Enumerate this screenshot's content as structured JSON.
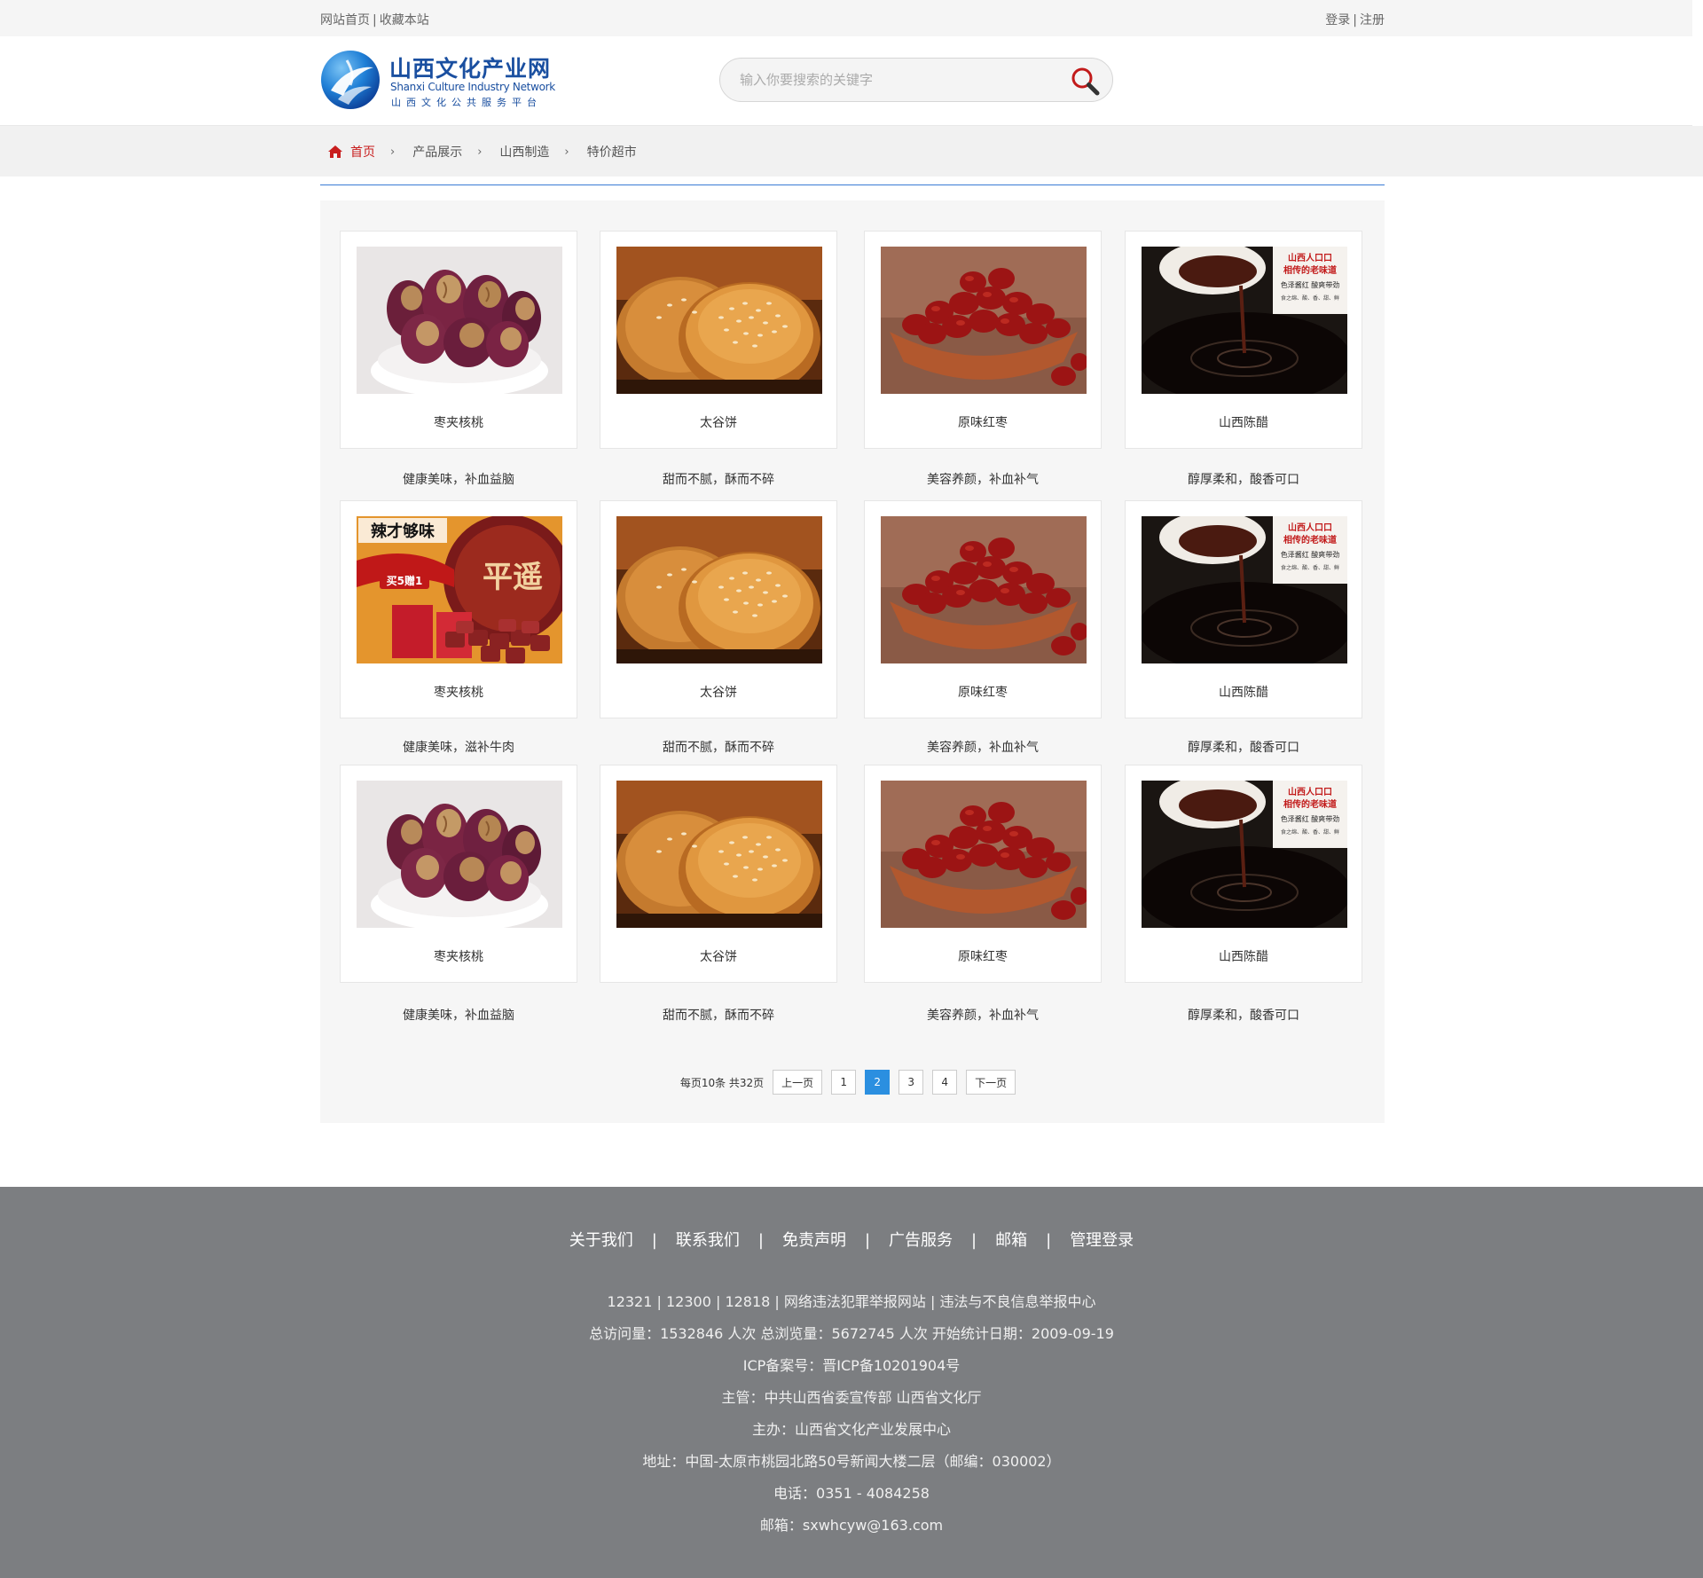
{
  "topbar": {
    "home_link": "网站首页",
    "bookmark_link": "收藏本站",
    "separator": "|",
    "login_link": "登录",
    "register_link": "注册"
  },
  "logo": {
    "name_cn": "山西文化产业网",
    "name_en": "Shanxi Culture Industry Network",
    "subtitle": "山西文化公共服务平台"
  },
  "search": {
    "placeholder": "输入你要搜索的关键字"
  },
  "breadcrumb": {
    "home": "首页",
    "items": [
      "产品展示",
      "山西制造",
      "特价超市"
    ],
    "arrow": "›"
  },
  "products": [
    {
      "name": "枣夹核桃",
      "desc": "健康美味，补血益脑",
      "image": "walnut-dates"
    },
    {
      "name": "太谷饼",
      "desc": "甜而不腻，酥而不碎",
      "image": "taigu-cake"
    },
    {
      "name": "原味红枣",
      "desc": "美容养颜，补血补气",
      "image": "red-dates"
    },
    {
      "name": "山西陈醋",
      "desc": "醇厚柔和，酸香可口",
      "image": "vinegar"
    },
    {
      "name": "枣夹核桃",
      "desc": "健康美味，滋补牛肉",
      "image": "beef-jerky"
    },
    {
      "name": "太谷饼",
      "desc": "甜而不腻，酥而不碎",
      "image": "taigu-cake"
    },
    {
      "name": "原味红枣",
      "desc": "美容养颜，补血补气",
      "image": "red-dates"
    },
    {
      "name": "山西陈醋",
      "desc": "醇厚柔和，酸香可口",
      "image": "vinegar"
    },
    {
      "name": "枣夹核桃",
      "desc": "健康美味，补血益脑",
      "image": "walnut-dates"
    },
    {
      "name": "太谷饼",
      "desc": "甜而不腻，酥而不碎",
      "image": "taigu-cake"
    },
    {
      "name": "原味红枣",
      "desc": "美容养颜，补血补气",
      "image": "red-dates"
    },
    {
      "name": "山西陈醋",
      "desc": "醇厚柔和，酸香可口",
      "image": "vinegar"
    }
  ],
  "image_text": {
    "vinegar_l1": "山西人口口",
    "vinegar_l2": "相传的老味道",
    "vinegar_l3": "色泽酱红 酸爽带劲",
    "vinegar_l4": "食之绵、酸、香、甜、鲜",
    "beef_l1": "辣才够味",
    "beef_l2": "买5赠1",
    "beef_l3": "平遥"
  },
  "pagination": {
    "info": "每页10条 共32页",
    "prev": "上一页",
    "pages": [
      "1",
      "2",
      "3",
      "4"
    ],
    "current": "2",
    "next": "下一页"
  },
  "footer": {
    "nav": [
      "关于我们",
      "联系我们",
      "免责声明",
      "广告服务",
      "邮箱",
      "管理登录"
    ],
    "nav_separator": "|",
    "lines": [
      "12321 | 12300 | 12818 | 网络违法犯罪举报网站 | 违法与不良信息举报中心",
      "总访问量：1532846 人次  总浏览量：5672745 人次  开始统计日期：2009-09-19",
      "ICP备案号：晋ICP备10201904号",
      "主管：中共山西省委宣传部 山西省文化厅",
      "主办：山西省文化产业发展中心",
      "地址：中国-太原市桃园北路50号新闻大楼二层（邮编：030002）",
      "电话：0351 - 4084258",
      "邮箱：sxwhcyw@163.com"
    ]
  },
  "colors": {
    "accent_blue": "#2b8fe0",
    "brand_blue": "#1a4fa0",
    "home_red": "#c81d1d",
    "footer_bg": "#7c7e81"
  }
}
